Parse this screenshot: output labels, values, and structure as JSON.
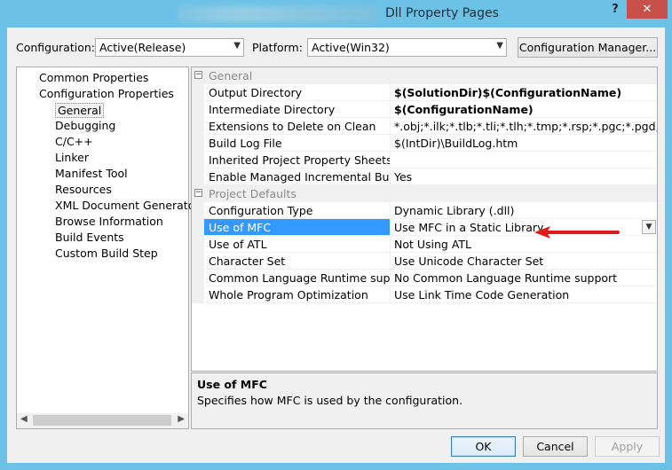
{
  "window": {
    "title": "Dll Property Pages",
    "help_label": "?",
    "close_label": "✕"
  },
  "toolbar": {
    "configuration_label": "Configuration:",
    "configuration_value": "Active(Release)",
    "platform_label": "Platform:",
    "platform_value": "Active(Win32)",
    "config_manager_label": "Configuration Manager..."
  },
  "tree": {
    "items": [
      {
        "label": "Common Properties",
        "level": 0
      },
      {
        "label": "Configuration Properties",
        "level": 0
      },
      {
        "label": "General",
        "level": 1,
        "selected": true
      },
      {
        "label": "Debugging",
        "level": 1
      },
      {
        "label": "C/C++",
        "level": 1
      },
      {
        "label": "Linker",
        "level": 1
      },
      {
        "label": "Manifest Tool",
        "level": 1
      },
      {
        "label": "Resources",
        "level": 1
      },
      {
        "label": "XML Document Generator",
        "level": 1
      },
      {
        "label": "Browse Information",
        "level": 1
      },
      {
        "label": "Build Events",
        "level": 1
      },
      {
        "label": "Custom Build Step",
        "level": 1
      }
    ]
  },
  "grid": {
    "categories": [
      {
        "title": "General",
        "toggle": "⊟",
        "rows": [
          {
            "name": "Output Directory",
            "value": "$(SolutionDir)$(ConfigurationName)",
            "bold": true
          },
          {
            "name": "Intermediate Directory",
            "value": "$(ConfigurationName)",
            "bold": true
          },
          {
            "name": "Extensions to Delete on Clean",
            "value": "*.obj;*.ilk;*.tlb;*.tli;*.tlh;*.tmp;*.rsp;*.pgc;*.pgd;*.meta;$(T",
            "bold": false
          },
          {
            "name": "Build Log File",
            "value": "$(IntDir)\\BuildLog.htm",
            "bold": false
          },
          {
            "name": "Inherited Project Property Sheets",
            "value": "",
            "bold": false
          },
          {
            "name": "Enable Managed Incremental Build",
            "value": "Yes",
            "bold": false
          }
        ]
      },
      {
        "title": "Project Defaults",
        "toggle": "⊟",
        "rows": [
          {
            "name": "Configuration Type",
            "value": "Dynamic Library (.dll)",
            "bold": false
          },
          {
            "name": "Use of MFC",
            "value": "Use MFC in a Static Library",
            "bold": false,
            "selected": true
          },
          {
            "name": "Use of ATL",
            "value": "Not Using ATL",
            "bold": false
          },
          {
            "name": "Character Set",
            "value": "Use Unicode Character Set",
            "bold": false
          },
          {
            "name": "Common Language Runtime support",
            "value": "No Common Language Runtime support",
            "bold": false
          },
          {
            "name": "Whole Program Optimization",
            "value": "Use Link Time Code Generation",
            "bold": false
          }
        ]
      }
    ]
  },
  "description": {
    "title": "Use of MFC",
    "text": "Specifies how MFC is used by the configuration."
  },
  "buttons": {
    "ok": "OK",
    "cancel": "Cancel",
    "apply": "Apply"
  },
  "colors": {
    "title_bar": "#6cc2e6",
    "close_button": "#c7504a",
    "selection": "#3399ff",
    "annotation_arrow": "#e0191b"
  }
}
